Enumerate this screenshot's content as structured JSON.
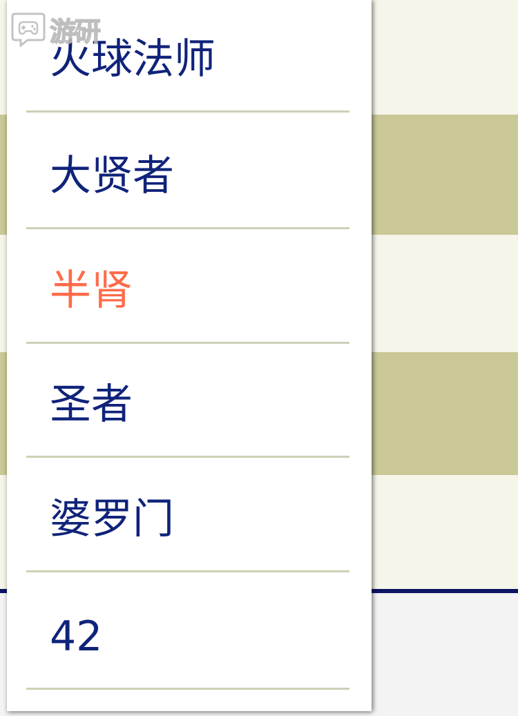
{
  "watermark": {
    "text": "游研",
    "icon": "gamepad-chat-icon"
  },
  "dropdown": {
    "items": [
      {
        "label": "火球法师",
        "selected": false
      },
      {
        "label": "大贤者",
        "selected": false
      },
      {
        "label": "半肾",
        "selected": true
      },
      {
        "label": "圣者",
        "selected": false
      },
      {
        "label": "婆罗门",
        "selected": false
      },
      {
        "label": "42",
        "selected": false
      }
    ]
  },
  "colors": {
    "item_text": "#10237a",
    "selected_text": "#ff6b4a",
    "divider": "#cdd0b5",
    "row_light": "#f5f5ea",
    "row_dark": "#c9c896",
    "rule": "#0c1466"
  }
}
